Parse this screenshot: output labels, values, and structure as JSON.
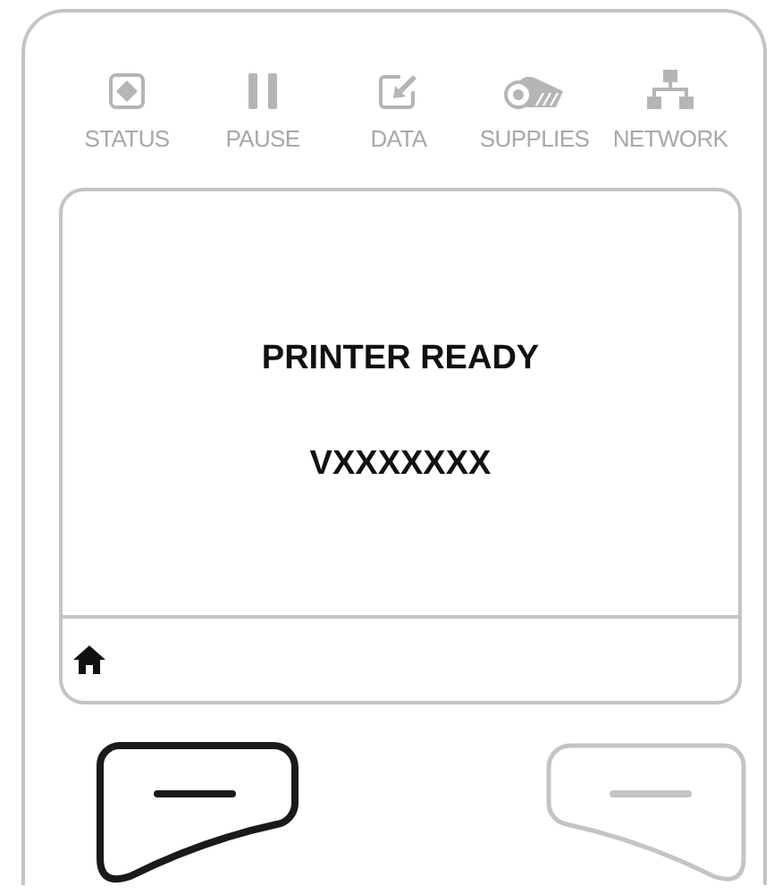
{
  "indicators": [
    {
      "kind": "status",
      "label": "STATUS"
    },
    {
      "kind": "pause",
      "label": "PAUSE"
    },
    {
      "kind": "data",
      "label": "DATA"
    },
    {
      "kind": "supplies",
      "label": "SUPPLIES"
    },
    {
      "kind": "network",
      "label": "NETWORK"
    }
  ],
  "screen": {
    "lines": [
      "PRINTER READY",
      "VXXXXXXX"
    ]
  },
  "softkeys": [
    {
      "kind": "left",
      "active": true
    },
    {
      "kind": "right",
      "active": false
    }
  ]
}
